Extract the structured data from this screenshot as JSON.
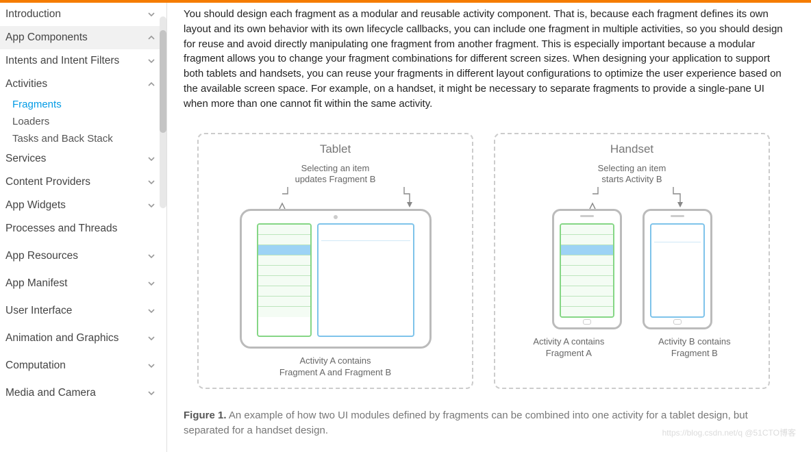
{
  "sidebar": {
    "items": [
      {
        "label": "Introduction",
        "expandable": true,
        "expanded": false
      },
      {
        "label": "App Components",
        "expandable": true,
        "expanded": true
      },
      {
        "label": "Intents and Intent Filters",
        "expandable": true,
        "expanded": false
      },
      {
        "label": "Activities",
        "expandable": true,
        "expanded": true,
        "children": [
          {
            "label": "Fragments",
            "selected": true
          },
          {
            "label": "Loaders",
            "selected": false
          },
          {
            "label": "Tasks and Back Stack",
            "selected": false
          }
        ]
      },
      {
        "label": "Services",
        "expandable": true,
        "expanded": false
      },
      {
        "label": "Content Providers",
        "expandable": true,
        "expanded": false
      },
      {
        "label": "App Widgets",
        "expandable": true,
        "expanded": false
      },
      {
        "label": "Processes and Threads",
        "expandable": false
      },
      {
        "label": "App Resources",
        "expandable": true,
        "expanded": false
      },
      {
        "label": "App Manifest",
        "expandable": true,
        "expanded": false
      },
      {
        "label": "User Interface",
        "expandable": true,
        "expanded": false
      },
      {
        "label": "Animation and Graphics",
        "expandable": true,
        "expanded": false
      },
      {
        "label": "Computation",
        "expandable": true,
        "expanded": false
      },
      {
        "label": "Media and Camera",
        "expandable": true,
        "expanded": false
      }
    ]
  },
  "content": {
    "paragraph": "You should design each fragment as a modular and reusable activity component. That is, because each fragment defines its own layout and its own behavior with its own lifecycle callbacks, you can include one fragment in multiple activities, so you should design for reuse and avoid directly manipulating one fragment from another fragment. This is especially important because a modular fragment allows you to change your fragment combinations for different screen sizes. When designing your application to support both tablets and handsets, you can reuse your fragments in different layout configurations to optimize the user experience based on the available screen space. For example, on a handset, it might be necessary to separate fragments to provide a single-pane UI when more than one cannot fit within the same activity."
  },
  "figure": {
    "tablet": {
      "title": "Tablet",
      "selecting_line1": "Selecting an item",
      "selecting_line2": "updates Fragment B",
      "caption_line1": "Activity A contains",
      "caption_line2": "Fragment A and Fragment B"
    },
    "handset": {
      "title": "Handset",
      "selecting_line1": "Selecting an item",
      "selecting_line2": "starts Activity B",
      "left_caption_line1": "Activity A contains",
      "left_caption_line2": "Fragment A",
      "right_caption_line1": "Activity B contains",
      "right_caption_line2": "Fragment B"
    },
    "caption_bold": "Figure 1.",
    "caption_rest": " An example of how two UI modules defined by fragments can be combined into one activity for a tablet design, but separated for a handset design."
  },
  "watermark": "https://blog.csdn.net/q @51CTO博客"
}
